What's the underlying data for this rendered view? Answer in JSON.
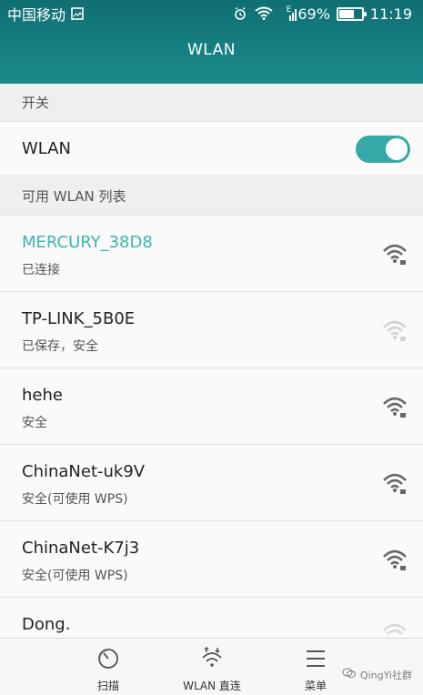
{
  "status_bar": {
    "carrier": "中国移动",
    "network_type": "E",
    "battery_percent": "69%",
    "battery_level": 0.69,
    "time": "11:19"
  },
  "header": {
    "title": "WLAN"
  },
  "sections": {
    "switch_header": "开关",
    "available_header": "可用 WLAN 列表"
  },
  "wlan_toggle": {
    "label": "WLAN",
    "state": "on"
  },
  "networks": [
    {
      "name": "MERCURY_38D8",
      "status": "已连接",
      "connected": true,
      "signal": 4
    },
    {
      "name": "TP-LINK_5B0E",
      "status": "已保存，安全",
      "connected": false,
      "signal": 1
    },
    {
      "name": "hehe",
      "status": "安全",
      "connected": false,
      "signal": 4
    },
    {
      "name": "ChinaNet-uk9V",
      "status": "安全(可使用 WPS)",
      "connected": false,
      "signal": 4
    },
    {
      "name": "ChinaNet-K7j3",
      "status": "安全(可使用 WPS)",
      "connected": false,
      "signal": 4
    },
    {
      "name": "Dong.",
      "status": "",
      "connected": false,
      "signal": 1
    }
  ],
  "bottom_nav": {
    "items": [
      {
        "label": "扫描",
        "icon": "scan-icon"
      },
      {
        "label": "WLAN 直连",
        "icon": "wifi-direct-icon"
      },
      {
        "label": "菜单",
        "icon": "menu-icon"
      }
    ]
  },
  "watermark": {
    "text": "QingYi社群"
  },
  "colors": {
    "header_bg": "#12787b",
    "accent": "#35a9a8",
    "connected_text": "#3ab6b1"
  }
}
